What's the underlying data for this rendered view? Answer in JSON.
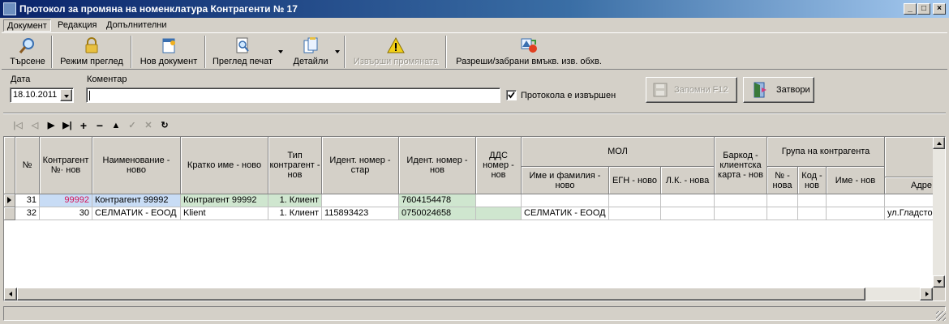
{
  "window": {
    "title": "Протокол за промяна на номенклатура Контрагенти № 17"
  },
  "menu": [
    "Документ",
    "Редакция",
    "Допълнителни"
  ],
  "toolbar": {
    "search": "Търсене",
    "view_mode": "Режим преглед",
    "new_doc": "Нов документ",
    "print_preview": "Преглед печат",
    "details": "Детайли",
    "execute_change": "Извърши промяната",
    "allow_deny": "Разреши/забрани вмъкв. изв. обхв."
  },
  "form": {
    "date_label": "Дата",
    "date_value": "18.10.2011",
    "comment_label": "Коментар",
    "comment_value": "",
    "done_checkbox_label": "Протокола е извършен",
    "done_checked": true,
    "save_button": "Запомни  F12",
    "close_button": "Затвори"
  },
  "nav_icons": [
    "first-icon",
    "prior-icon",
    "next-icon",
    "last-icon",
    "insert-icon",
    "delete-icon",
    "edit-icon",
    "post-icon",
    "cancel-icon",
    "refresh-icon"
  ],
  "grid": {
    "headers": {
      "num": "№",
      "contr_no": "Контрагент №· нов",
      "name_new": "Наименование - ново",
      "short_new": "Кратко име - ново",
      "type_new": "Тип контрагент - нов",
      "ident_old": "Идент. номер - стар",
      "ident_new": "Идент. номер - нов",
      "vat_new": "ДДС номер - нов",
      "mol_group": "МОЛ",
      "mol_name": "Име и фамилия - ново",
      "mol_egn": "ЕГН - ново",
      "mol_lk": "Л.К. - нова",
      "barcode": "Баркод - клиентска карта - нов",
      "grp_group": "Група на контрагента",
      "grp_no": "№ - нова",
      "grp_code": "Код - нов",
      "grp_name": "Име - нов",
      "addr": "Адре"
    },
    "rows": [
      {
        "num": "31",
        "contr_no": "99992",
        "name_new": "Контрагент 99992",
        "short_new": "Контрагент 99992",
        "type_new": "1. Клиент",
        "ident_old": "",
        "ident_new": "7604154478",
        "vat_new": "",
        "mol_name": "",
        "mol_egn": "",
        "mol_lk": "",
        "barcode": "",
        "grp_no": "",
        "grp_code": "",
        "grp_name": "",
        "addr": ""
      },
      {
        "num": "32",
        "contr_no": "30",
        "name_new": "СЕЛМАТИК - ЕООД",
        "short_new": "Klient",
        "type_new": "1. Клиент",
        "ident_old": "115893423",
        "ident_new": "0750024658",
        "vat_new": "",
        "mol_name": "СЕЛМАТИК - ЕООД",
        "mol_egn": "",
        "mol_lk": "",
        "barcode": "",
        "grp_no": "",
        "grp_code": "",
        "grp_name": "",
        "addr": "ул.Гладсто"
      }
    ]
  },
  "colors": {
    "title_start": "#0a246a",
    "highlight_green": "#cfe6cf",
    "highlight_blue": "#c8dcf5",
    "red_value": "#d4145a"
  }
}
